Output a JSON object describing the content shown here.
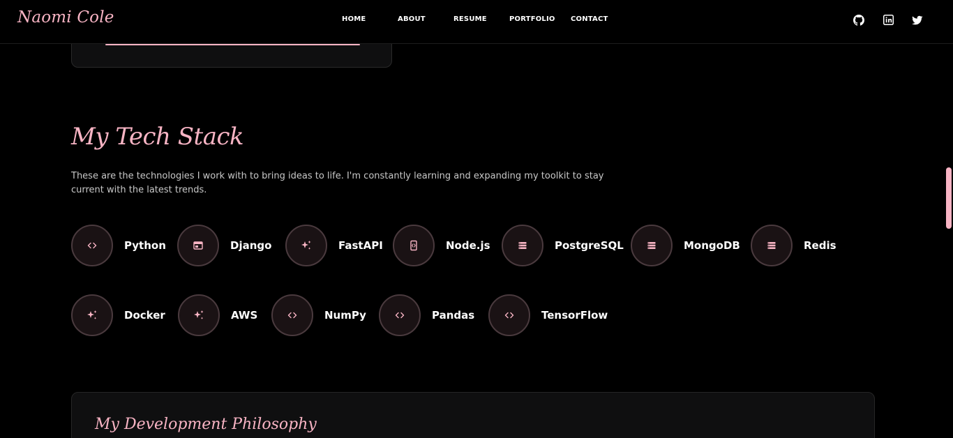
{
  "header": {
    "logo": "Naomi Cole",
    "nav": [
      "HOME",
      "ABOUT",
      "RESUME",
      "PORTFOLIO",
      "CONTACT"
    ],
    "social": [
      "github-icon",
      "linkedin-icon",
      "twitter-icon"
    ]
  },
  "tech_stack": {
    "title": "My Tech Stack",
    "description": "These are the technologies I work with to bring ideas to life. I'm constantly learning and expanding my toolkit to stay current with the latest trends.",
    "items": [
      {
        "name": "Python",
        "icon": "code-icon"
      },
      {
        "name": "Django",
        "icon": "browser-window-icon"
      },
      {
        "name": "FastAPI",
        "icon": "sparkles-icon"
      },
      {
        "name": "Node.js",
        "icon": "mobile-code-icon"
      },
      {
        "name": "PostgreSQL",
        "icon": "database-icon"
      },
      {
        "name": "MongoDB",
        "icon": "database-icon"
      },
      {
        "name": "Redis",
        "icon": "database-icon"
      },
      {
        "name": "Docker",
        "icon": "sparkles-icon"
      },
      {
        "name": "AWS",
        "icon": "sparkles-icon"
      },
      {
        "name": "NumPy",
        "icon": "code-icon"
      },
      {
        "name": "Pandas",
        "icon": "code-icon"
      },
      {
        "name": "TensorFlow",
        "icon": "code-icon"
      }
    ]
  },
  "philosophy": {
    "title": "My Development Philosophy"
  },
  "colors": {
    "accent": "#f8b4c4",
    "background": "#000000",
    "card": "#0f0f10"
  }
}
